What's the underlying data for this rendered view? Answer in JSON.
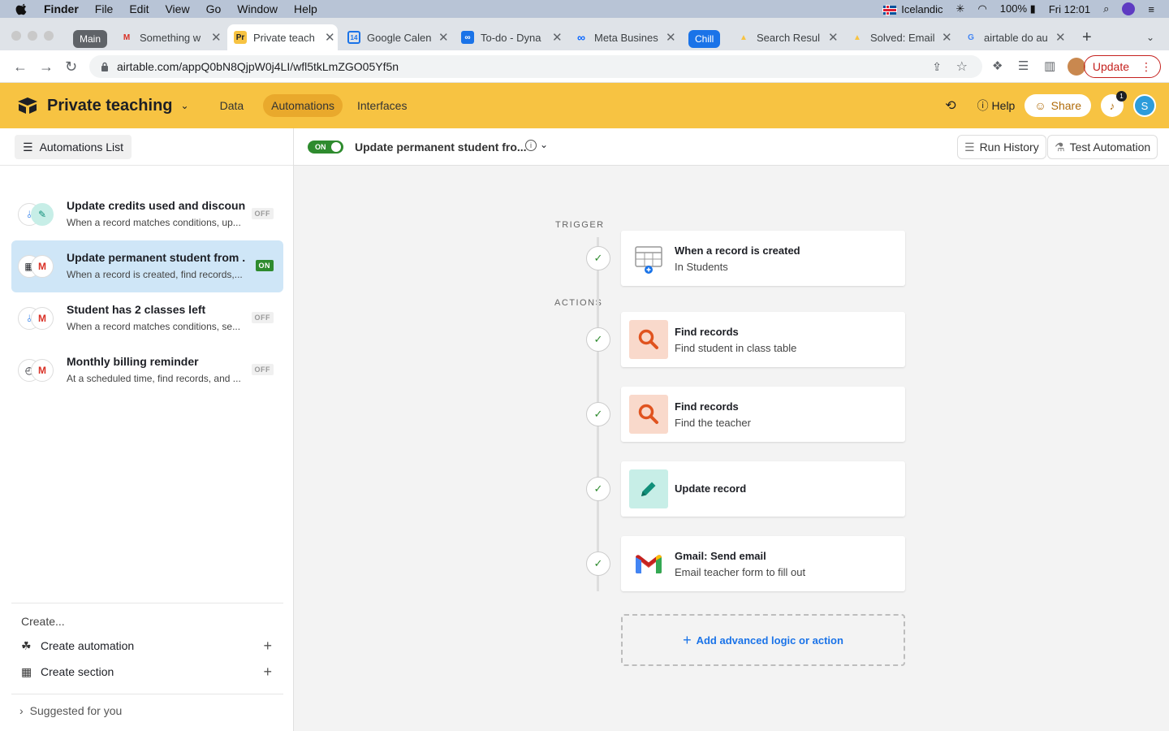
{
  "menubar": {
    "app": "Finder",
    "items": [
      "File",
      "Edit",
      "View",
      "Go",
      "Window",
      "Help"
    ],
    "input_source": "Icelandic",
    "battery": "100%",
    "clock": "Fri 12:01"
  },
  "tabs": [
    {
      "group": "Main",
      "group_color": "#5f6368"
    },
    {
      "title": "Something w",
      "icon": "gmail-icon"
    },
    {
      "title": "Private teach",
      "icon": "airtable-icon",
      "active": true
    },
    {
      "title": "Google Calen",
      "icon": "calendar-icon"
    },
    {
      "title": "To-do - Dyna",
      "icon": "todo-icon"
    },
    {
      "title": "Meta Busines",
      "icon": "meta-icon"
    },
    {
      "group": "Chill",
      "group_color": "#1a73e8"
    },
    {
      "title": "Search Resul",
      "icon": "airtable-icon"
    },
    {
      "title": "Solved: Email",
      "icon": "airtable-icon"
    },
    {
      "title": "airtable do au",
      "icon": "google-icon"
    }
  ],
  "address": {
    "url": "airtable.com/appQ0bN8QjpW0j4LI/wfl5tkLmZGO05Yf5n",
    "update_label": "Update"
  },
  "header": {
    "base_title": "Private teaching",
    "nav": [
      "Data",
      "Automations",
      "Interfaces"
    ],
    "active_nav": "Automations",
    "help": "Help",
    "share": "Share",
    "notifications": "1",
    "avatar_initial": "S"
  },
  "sidebar": {
    "list_button": "Automations List",
    "automations": [
      {
        "name": "Update credits used and discount",
        "desc": "When a record matches conditions, up...",
        "status": "OFF"
      },
      {
        "name": "Update permanent student from ...",
        "desc": "When a record is created, find records,...",
        "status": "ON",
        "active": true
      },
      {
        "name": "Student has 2 classes left",
        "desc": "When a record matches conditions, se...",
        "status": "OFF"
      },
      {
        "name": "Monthly billing reminder",
        "desc": "At a scheduled time, find records, and ...",
        "status": "OFF"
      }
    ],
    "create_label": "Create...",
    "create_automation": "Create automation",
    "create_section": "Create section",
    "suggested": "Suggested for you"
  },
  "main": {
    "toggle": "ON",
    "title": "Update permanent student fro...",
    "run_history": "Run History",
    "test_automation": "Test Automation",
    "trigger_label": "TRIGGER",
    "actions_label": "ACTIONS",
    "trigger": {
      "title": "When a record is created",
      "sub": "In Students",
      "icon": "table-plus-icon"
    },
    "actions": [
      {
        "title": "Find records",
        "sub": "Find student in class table",
        "icon": "search-icon",
        "color": "#f9d9cb"
      },
      {
        "title": "Find records",
        "sub": "Find the teacher",
        "icon": "search-icon",
        "color": "#f9d9cb"
      },
      {
        "title": "Update record",
        "sub": "",
        "icon": "pencil-icon",
        "color": "#c7eee7"
      },
      {
        "title": "Gmail: Send email",
        "sub": "Email teacher form to fill out",
        "icon": "gmail-icon",
        "color": "#ffffff"
      }
    ],
    "add_action": "Add advanced logic or action"
  }
}
